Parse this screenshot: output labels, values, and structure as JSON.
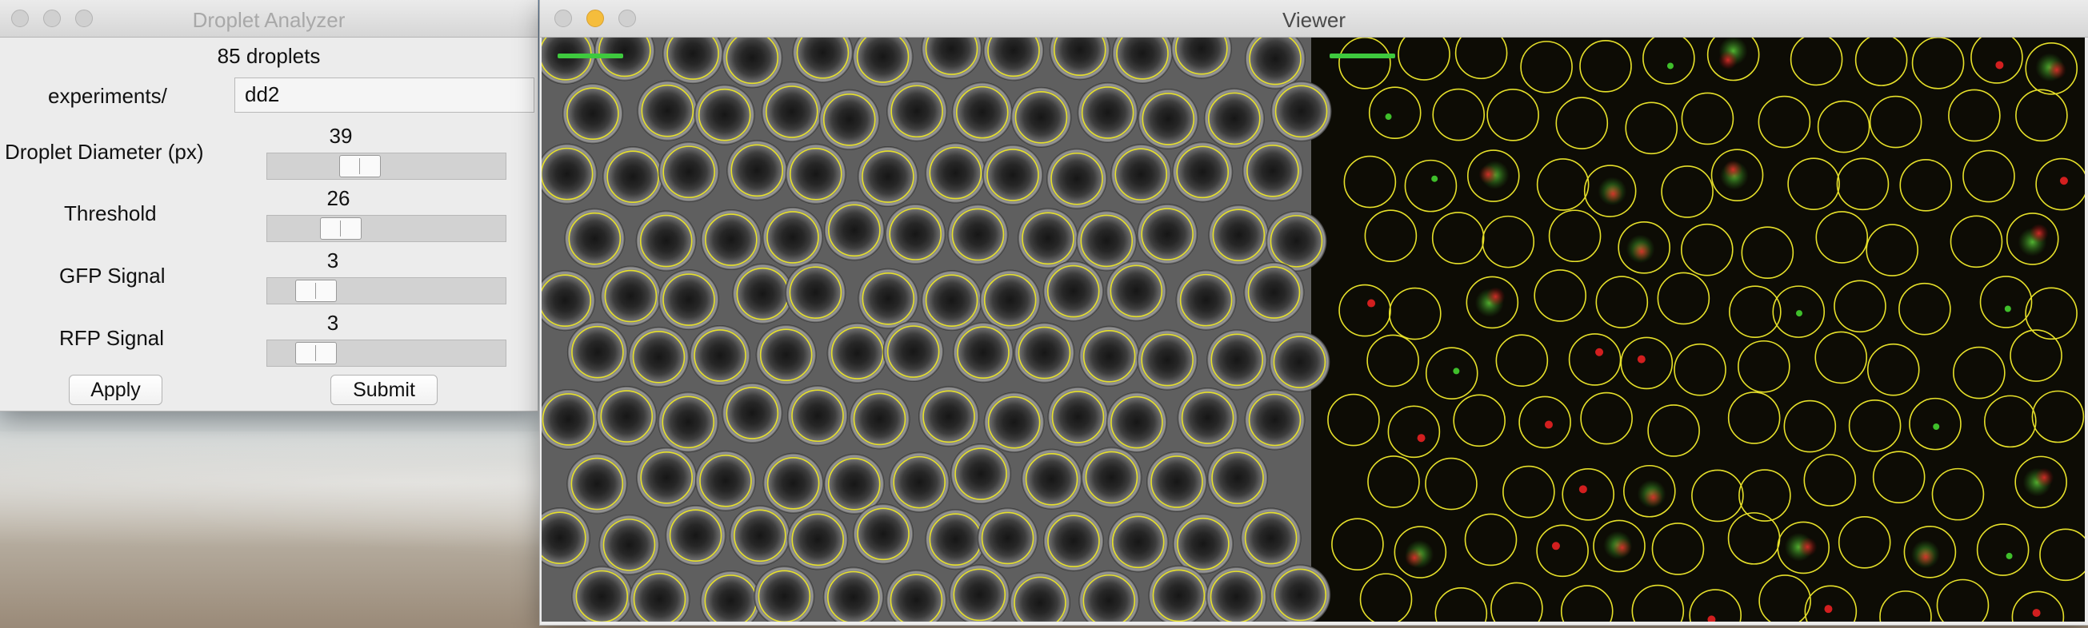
{
  "analyzer": {
    "title": "Droplet Analyzer",
    "count_text": "85 droplets",
    "experiments_label": "experiments/",
    "experiments_value": "dd2",
    "sliders": [
      {
        "label": "Droplet Diameter (px)",
        "value": "39",
        "fraction": 0.36
      },
      {
        "label": "Threshold",
        "value": "26",
        "fraction": 0.26
      },
      {
        "label": "GFP Signal",
        "value": "3",
        "fraction": 0.13
      },
      {
        "label": "RFP Signal",
        "value": "3",
        "fraction": 0.13
      }
    ],
    "apply_label": "Apply",
    "submit_label": "Submit"
  },
  "viewer": {
    "title": "Viewer"
  },
  "colors": {
    "circle_outline": "#e6e02a",
    "scale_bar": "#3ec93e",
    "fluor_background": "#0d0c05",
    "brightfield_background": "#5f5f5f",
    "gfp": "#3fbf2b",
    "rfp": "#d21f1f"
  }
}
